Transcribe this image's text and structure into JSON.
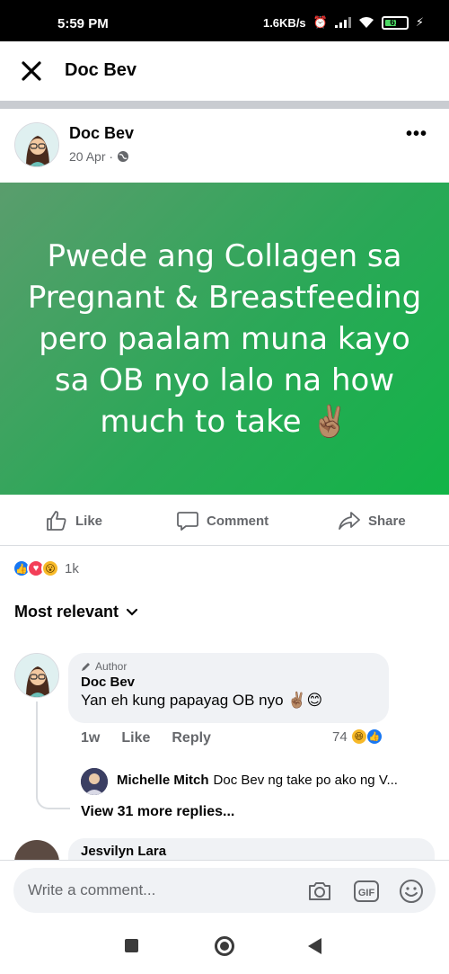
{
  "status_bar": {
    "time": "5:59 PM",
    "network_speed": "1.6KB/s",
    "battery": "61"
  },
  "header": {
    "title": "Doc Bev",
    "close_icon": "close-icon"
  },
  "post": {
    "author": "Doc Bev",
    "date": "20 Apr · ",
    "privacy_icon": "globe-icon",
    "banner_text": "Pwede ang Collagen sa Pregnant & Breastfeeding pero paalam muna kayo sa OB nyo lalo na how much to take ✌🏽",
    "banner_colors": [
      "#5a9d6d",
      "#2aa857",
      "#12b447"
    ]
  },
  "actions": {
    "like": "Like",
    "comment": "Comment",
    "share": "Share"
  },
  "reactions": {
    "count": "1k"
  },
  "sort": {
    "label": "Most relevant"
  },
  "comment": {
    "badge": "Author",
    "name": "Doc Bev",
    "text": "Yan eh kung papayag OB nyo ✌🏽😊",
    "age": "1w",
    "like": "Like",
    "reply": "Reply",
    "reaction_count": "74"
  },
  "reply": {
    "name": "Michelle Mitch",
    "text": "Doc Bev  ng take po ako ng V..."
  },
  "more_replies": "View 31 more replies...",
  "next_comment": {
    "name": "Jesvilyn Lara"
  },
  "composer": {
    "placeholder": "Write a comment...",
    "gif_label": "GIF"
  },
  "colors": {
    "accent": "#1877f2",
    "muted": "#65676b"
  }
}
